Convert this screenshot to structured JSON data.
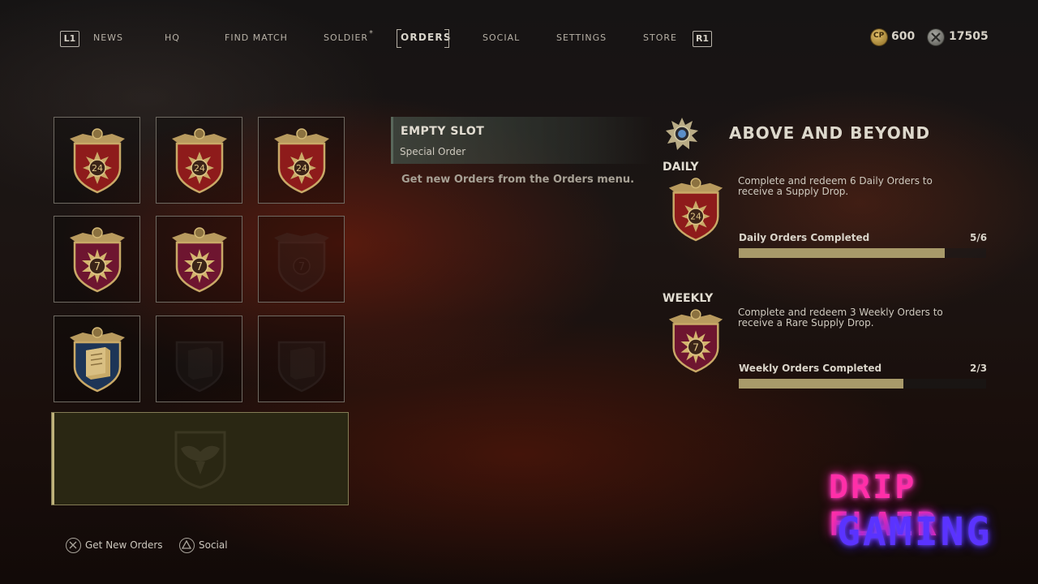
{
  "nav": {
    "left_button": "L1",
    "right_button": "R1",
    "items": [
      "NEWS",
      "HQ",
      "FIND MATCH",
      "SOLDIER",
      "ORDERS",
      "SOCIAL",
      "SETTINGS",
      "STORE"
    ],
    "active": "ORDERS",
    "soldier_star": "*"
  },
  "currency": {
    "cp": {
      "icon": "cp-coin-icon",
      "label": "CP",
      "value": "600"
    },
    "credits": {
      "icon": "armory-credits-icon",
      "value": "17505"
    }
  },
  "order_slots": [
    {
      "type": "daily",
      "number": "24",
      "state": "filled"
    },
    {
      "type": "daily",
      "number": "24",
      "state": "filled"
    },
    {
      "type": "daily",
      "number": "24",
      "state": "filled"
    },
    {
      "type": "weekly",
      "number": "7",
      "state": "filled"
    },
    {
      "type": "weekly",
      "number": "7",
      "state": "filled"
    },
    {
      "type": "weekly",
      "number": "7",
      "state": "empty"
    },
    {
      "type": "contract",
      "state": "filled"
    },
    {
      "type": "contract",
      "state": "empty"
    },
    {
      "type": "contract",
      "state": "empty"
    }
  ],
  "special_slot": {
    "state": "empty",
    "icon": "eagle-crest-icon"
  },
  "detail": {
    "title": "EMPTY SLOT",
    "subtitle": "Special Order",
    "hint": "Get new Orders from the Orders menu."
  },
  "above_and_beyond": {
    "title": "ABOVE AND BEYOND",
    "daily": {
      "heading": "DAILY",
      "badge_number": "24",
      "description": "Complete and redeem 6 Daily Orders to receive a Supply Drop.",
      "progress_label": "Daily Orders Completed",
      "progress_text": "5/6",
      "progress_fraction": 0.8333
    },
    "weekly": {
      "heading": "WEEKLY",
      "badge_number": "7",
      "description": "Complete and redeem 3 Weekly Orders to receive a Rare Supply Drop.",
      "progress_label": "Weekly Orders Completed",
      "progress_text": "2/3",
      "progress_fraction": 0.6667
    }
  },
  "prompts": [
    {
      "icon": "cross-button-icon",
      "label": "Get New Orders"
    },
    {
      "icon": "triangle-button-icon",
      "label": "Social"
    }
  ],
  "watermark": {
    "line1": "DRIP FLAIR",
    "line2": "GAMING"
  },
  "colors": {
    "accent_gold": "#a89a6a",
    "daily_badge_red": "#8e1b1b",
    "weekly_badge_maroon": "#6e1530",
    "contract_badge_blue": "#1d3557"
  }
}
